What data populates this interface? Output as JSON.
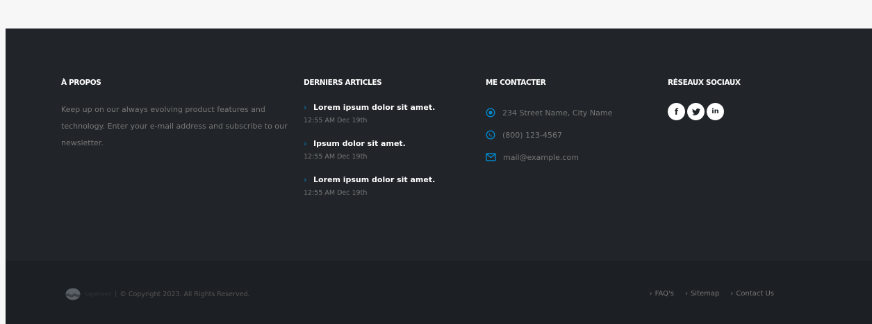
{
  "about": {
    "heading": "À PROPOS",
    "text": "Keep up on our always evolving product features and technology. Enter your e-mail address and subscribe to our newsletter."
  },
  "articles": {
    "heading": "DERNIERS ARTICLES",
    "items": [
      {
        "title": "Lorem ipsum dolor sit amet.",
        "date": "12:55 AM Dec 19th"
      },
      {
        "title": "Ipsum dolor sit amet.",
        "date": "12:55 AM Dec 19th"
      },
      {
        "title": "Lorem ipsum dolor sit amet.",
        "date": "12:55 AM Dec 19th"
      }
    ]
  },
  "contact": {
    "heading": "ME CONTACTER",
    "address": "234 Street Name, City Name",
    "phone": "(800) 123-4567",
    "email": "mail@example.com"
  },
  "social": {
    "heading": "RÉSEAUX SOCIAUX",
    "icons": [
      "facebook-icon",
      "twitter-icon",
      "linkedin-icon"
    ],
    "facebook": "f",
    "linkedin": "in"
  },
  "copyright": {
    "logo_text": "Logobrand",
    "text": "© Copyright 2023. All Rights Reserved."
  },
  "bottom_links": [
    {
      "label": "FAQ's"
    },
    {
      "label": "Sitemap"
    },
    {
      "label": "Contact Us"
    }
  ],
  "colors": {
    "footer_bg": "#212529",
    "copyright_bg": "#1c1f23",
    "accent": "#0088cc"
  }
}
